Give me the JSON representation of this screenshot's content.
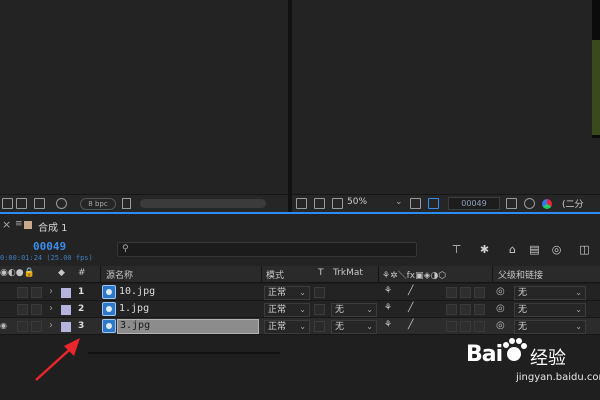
{
  "project_panel": {
    "bit_depth": "8 bpc"
  },
  "viewer": {
    "zoom": "50%",
    "frame": "00049",
    "resolution": "(二分"
  },
  "timeline": {
    "tab_close": "×",
    "tab_menu": "≡",
    "tab_name": "合成 1",
    "tab_swatch_color": "#c9a98a",
    "timecode": "00049",
    "timecode_sub": "0:00:01:24 (25.00 fps)",
    "search_placeholder": "",
    "headers": {
      "number": "#",
      "source_name": "源名称",
      "mode": "模式",
      "t": "T",
      "trkmat": "TrkMat",
      "parent": "父级和链接"
    },
    "layers": [
      {
        "num": "1",
        "name": "10.jpg",
        "mode": "正常",
        "trkmat": "",
        "parent": "无",
        "selected": false
      },
      {
        "num": "2",
        "name": "1.jpg",
        "mode": "正常",
        "trkmat": "无",
        "parent": "无",
        "selected": false
      },
      {
        "num": "3",
        "name": "3.jpg",
        "mode": "正常",
        "trkmat": "无",
        "parent": "无",
        "selected": true
      }
    ],
    "label_color": "#b4b4dc"
  },
  "watermark": {
    "brand": "Bai",
    "brand_cn": "经验",
    "url": "jingyan.baidu.com"
  },
  "accent_color": "#2d8cf0"
}
